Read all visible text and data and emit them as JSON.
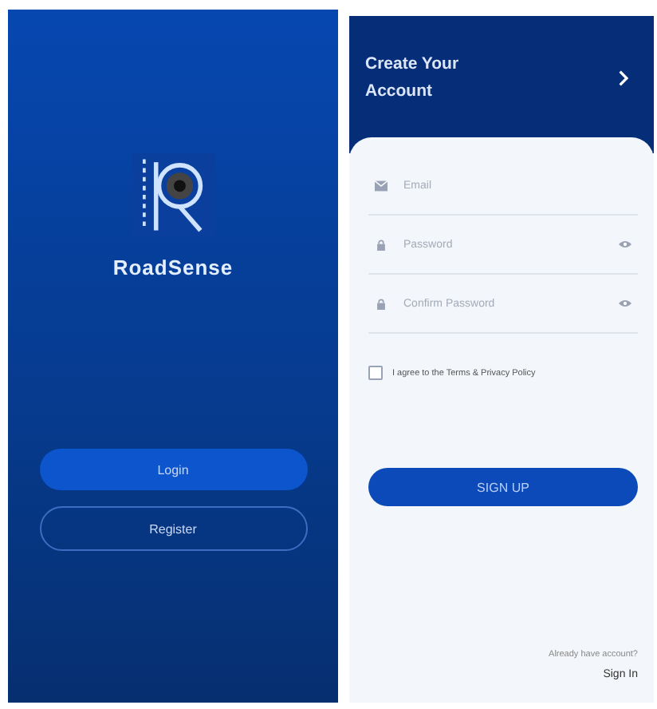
{
  "welcome": {
    "app_name": "RoadSense",
    "buttons": [
      {
        "label": "Login",
        "kind": "filled"
      },
      {
        "label": "Register",
        "kind": "outline"
      }
    ]
  },
  "signup": {
    "title": "Create Your Account",
    "fields": [
      {
        "placeholder": "Email",
        "kind": "email",
        "reveal": false
      },
      {
        "placeholder": "Password",
        "kind": "password",
        "reveal": true
      },
      {
        "placeholder": "Confirm Password",
        "kind": "password",
        "reveal": true
      }
    ],
    "agree": {
      "text": "I agree to the Terms & Privacy Policy",
      "checked": false
    },
    "submit": "SIGN UP",
    "footer_prompt": "Already have account?",
    "footer_link": "Sign In"
  }
}
